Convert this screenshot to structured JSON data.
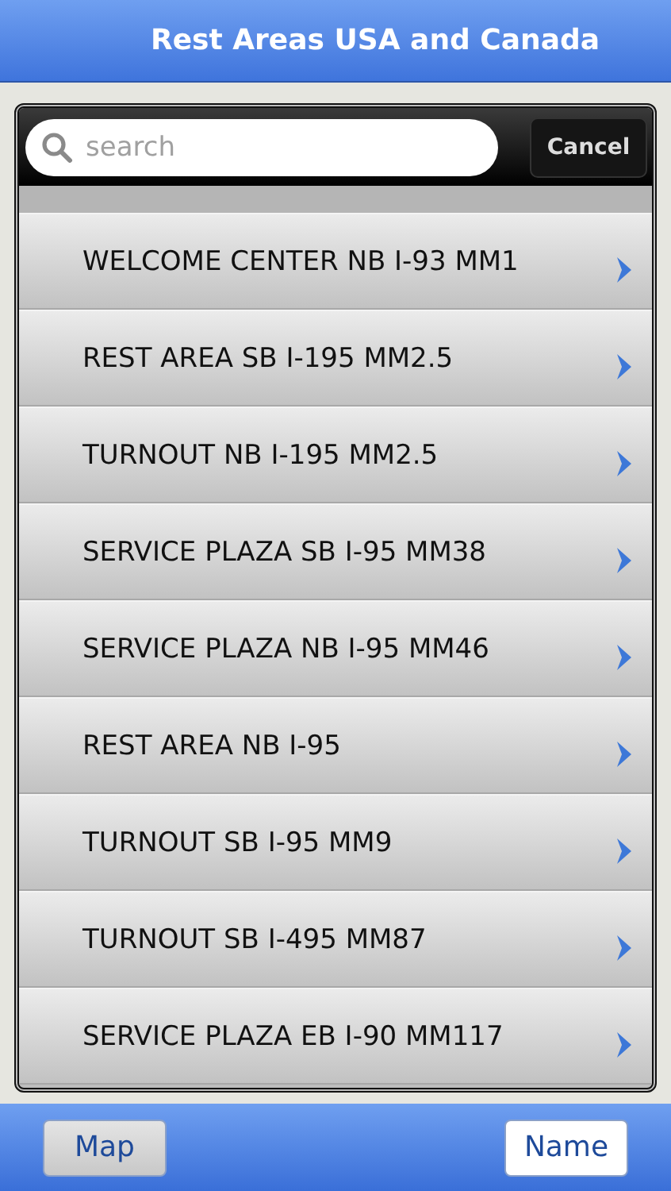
{
  "title": "Rest Areas USA and Canada",
  "search": {
    "placeholder": "search",
    "cancel": "Cancel"
  },
  "rows": [
    {
      "label": "WELCOME CENTER NB I-93 MM1"
    },
    {
      "label": "REST AREA SB I-195 MM2.5"
    },
    {
      "label": "TURNOUT NB I-195 MM2.5"
    },
    {
      "label": "SERVICE PLAZA SB I-95 MM38"
    },
    {
      "label": "SERVICE PLAZA NB I-95 MM46"
    },
    {
      "label": "REST AREA NB I-95"
    },
    {
      "label": "TURNOUT SB I-95 MM9"
    },
    {
      "label": "TURNOUT SB I-495 MM87"
    },
    {
      "label": "SERVICE PLAZA EB I-90 MM117"
    }
  ],
  "toolbar": [
    {
      "label": "Map",
      "selected": true
    },
    {
      "label": "Name",
      "selected": false
    }
  ]
}
